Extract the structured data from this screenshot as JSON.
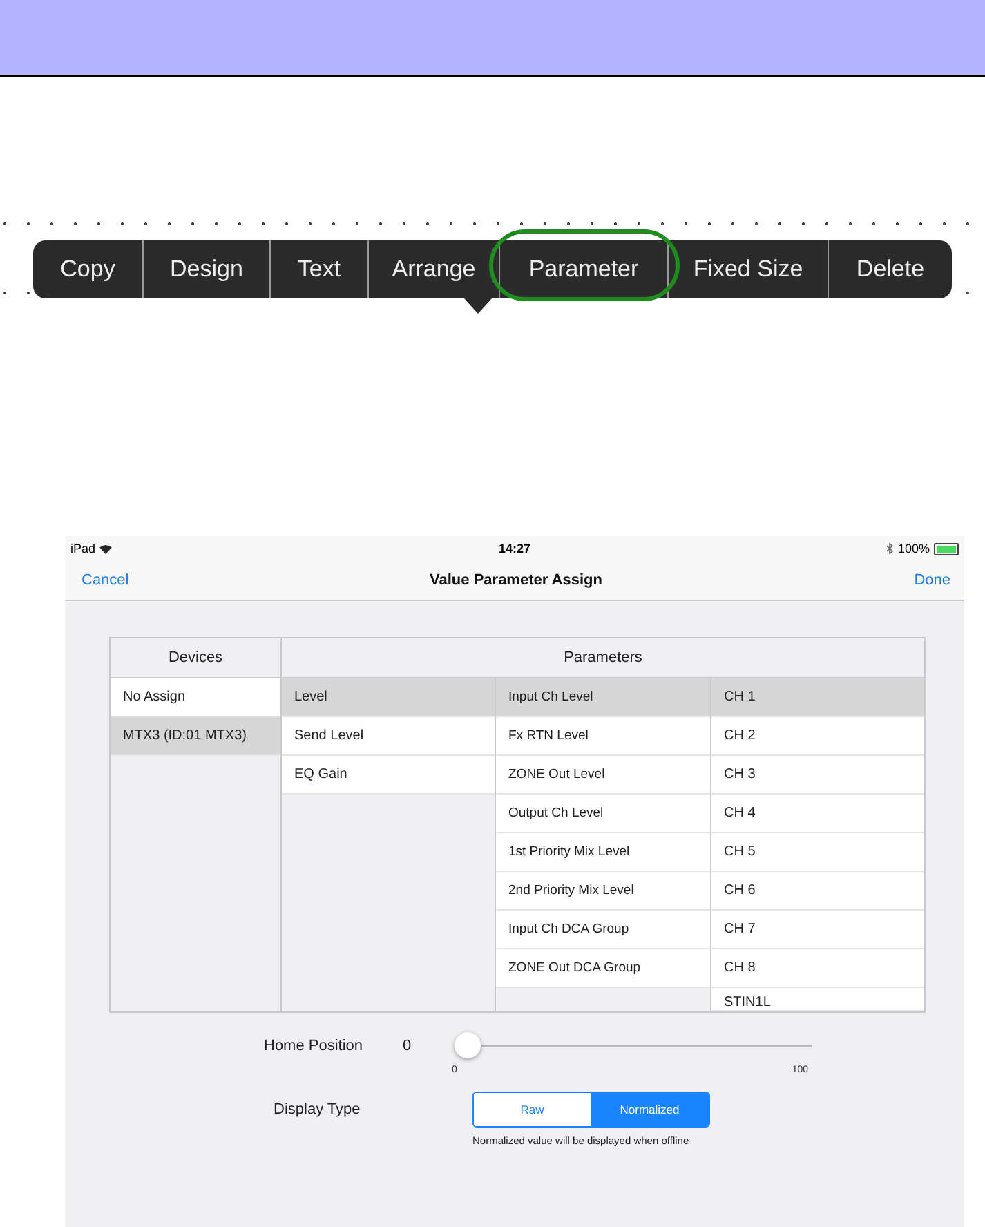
{
  "menu": {
    "items": [
      {
        "label": "Copy",
        "highlighted": false
      },
      {
        "label": "Design",
        "highlighted": false
      },
      {
        "label": "Text",
        "highlighted": false
      },
      {
        "label": "Arrange",
        "highlighted": false
      },
      {
        "label": "Parameter",
        "highlighted": true
      },
      {
        "label": "Fixed Size",
        "highlighted": false
      },
      {
        "label": "Delete",
        "highlighted": false
      }
    ]
  },
  "status_bar": {
    "device": "iPad",
    "time": "14:27",
    "battery": "100%"
  },
  "nav_bar": {
    "left": "Cancel",
    "title": "Value Parameter Assign",
    "right": "Done"
  },
  "devices": {
    "header": "Devices",
    "items": [
      {
        "label": "No Assign",
        "selected": false
      },
      {
        "label": "MTX3 (ID:01 MTX3)",
        "selected": true
      }
    ]
  },
  "parameters": {
    "header": "Parameters",
    "types": [
      {
        "label": "Level",
        "selected": true
      },
      {
        "label": "Send Level",
        "selected": false
      },
      {
        "label": "EQ Gain",
        "selected": false
      }
    ],
    "params": [
      {
        "label": "Input Ch Level",
        "selected": true
      },
      {
        "label": "Fx RTN Level",
        "selected": false
      },
      {
        "label": "ZONE Out Level",
        "selected": false
      },
      {
        "label": "Output Ch Level",
        "selected": false
      },
      {
        "label": "1st Priority Mix Level",
        "selected": false
      },
      {
        "label": "2nd Priority Mix Level",
        "selected": false
      },
      {
        "label": "Input Ch DCA Group",
        "selected": false
      },
      {
        "label": "ZONE Out DCA Group",
        "selected": false
      }
    ],
    "channels": [
      {
        "label": "CH 1",
        "selected": true
      },
      {
        "label": "CH 2",
        "selected": false
      },
      {
        "label": "CH 3",
        "selected": false
      },
      {
        "label": "CH 4",
        "selected": false
      },
      {
        "label": "CH 5",
        "selected": false
      },
      {
        "label": "CH 6",
        "selected": false
      },
      {
        "label": "CH 7",
        "selected": false
      },
      {
        "label": "CH 8",
        "selected": false
      },
      {
        "label": "STIN1L",
        "selected": false
      }
    ]
  },
  "home_position": {
    "label": "Home Position",
    "value": "0",
    "level": 0,
    "min": "0",
    "max": "100"
  },
  "display_type": {
    "label": "Display Type",
    "options": [
      {
        "label": "Raw",
        "selected": false
      },
      {
        "label": "Normalized",
        "selected": true
      }
    ],
    "note": "Normalized value will be displayed when offline"
  }
}
